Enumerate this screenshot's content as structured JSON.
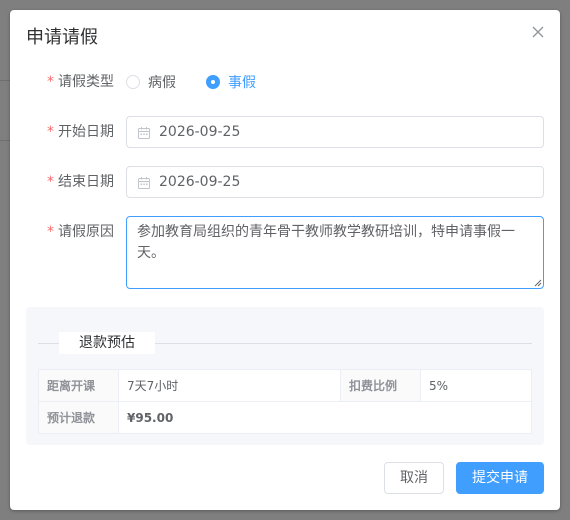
{
  "dialog": {
    "title": "申请请假"
  },
  "form": {
    "required_mark": "*",
    "leave_type": {
      "label": "请假类型",
      "options": [
        "病假",
        "事假"
      ],
      "selected": "事假"
    },
    "start_date": {
      "label": "开始日期",
      "value": "2026-09-25"
    },
    "end_date": {
      "label": "结束日期",
      "value": "2026-09-25"
    },
    "reason": {
      "label": "请假原因",
      "value": "参加教育局组织的青年骨干教师教学教研培训，特申请事假一天。"
    }
  },
  "refund": {
    "title": "退款预估",
    "rows": [
      {
        "label": "距离开课",
        "value": "7天7小时"
      },
      {
        "label": "扣费比例",
        "value": "5%"
      },
      {
        "label": "预计退款",
        "value": "¥95.00"
      }
    ]
  },
  "footer": {
    "cancel_label": "取消",
    "submit_label": "提交申请"
  },
  "colors": {
    "primary": "#409eff",
    "required": "#f56c6c",
    "warning": "#e6a23c",
    "success": "#67c23a"
  },
  "icons": {
    "close": "close-icon",
    "calendar": "calendar-icon"
  }
}
